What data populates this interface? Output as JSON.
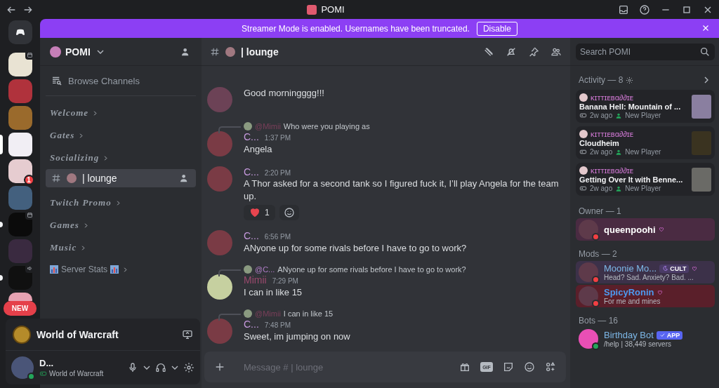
{
  "titlebar": {
    "title": "POMI"
  },
  "banner": {
    "text": "Streamer Mode is enabled. Usernames have been truncated.",
    "button": "Disable"
  },
  "servers": [
    {
      "kind": "event",
      "selected": false,
      "unread": false
    },
    {
      "kind": "plain",
      "selected": false,
      "unread": false
    },
    {
      "kind": "plain",
      "selected": false,
      "unread": false
    },
    {
      "kind": "plain",
      "selected": true,
      "unread": false
    },
    {
      "kind": "plain",
      "selected": false,
      "unread": false,
      "badge": "1"
    },
    {
      "kind": "plain",
      "selected": false,
      "unread": false
    },
    {
      "kind": "event",
      "selected": false,
      "unread": true
    },
    {
      "kind": "plain",
      "selected": false,
      "unread": false
    },
    {
      "kind": "voice",
      "selected": false,
      "unread": true
    },
    {
      "kind": "plain",
      "selected": false,
      "unread": false
    }
  ],
  "rail_pill": "NEW",
  "sidebar": {
    "server_name": "POMI",
    "browse": "Browse Channels",
    "categories": [
      {
        "kind": "fancy",
        "name": "Welcome"
      },
      {
        "kind": "fancy",
        "name": "Gates"
      },
      {
        "kind": "fancy",
        "name": "Socializing",
        "channels": [
          {
            "name": "| lounge",
            "selected": true
          }
        ]
      },
      {
        "kind": "fancy",
        "name": "Twitch Promo"
      },
      {
        "kind": "fancy",
        "name": "Games"
      },
      {
        "kind": "fancy",
        "name": "Music"
      },
      {
        "kind": "stats",
        "name": "Server Stats"
      }
    ]
  },
  "activity_panel": {
    "game": "World of Warcraft"
  },
  "user_panel": {
    "name": "D...",
    "status": "World of Warcraft"
  },
  "chat": {
    "channel": "| lounge",
    "messages": [
      {
        "kind": "continuation",
        "text": "Good morningggg!!!"
      },
      {
        "kind": "message",
        "reply": {
          "author": "@Mimii",
          "color": "#7b3f5a",
          "text": "Who were you playing as"
        },
        "author": "C...",
        "color": "#c79adf",
        "time": "1:37 PM",
        "text": "Angela"
      },
      {
        "kind": "message",
        "author": "C...",
        "color": "#c79adf",
        "time": "2:20 PM",
        "text": "A Thor asked for a second tank so I figured fuck it, I’ll play Angela for the team up.",
        "reactions": [
          {
            "count": "1"
          }
        ]
      },
      {
        "kind": "message",
        "author": "C...",
        "color": "#c79adf",
        "time": "6:56 PM",
        "text": "ANyone up for some rivals before I have to go to work?"
      },
      {
        "kind": "message",
        "reply": {
          "author": "@C...",
          "color": "#b07ec8",
          "text": "ANyone up for some rivals before I have to go to work?"
        },
        "author": "Mimii",
        "color": "#9b4a6e",
        "time": "7:29 PM",
        "text": "I can in like 15"
      },
      {
        "kind": "message",
        "reply": {
          "author": "@Mimii",
          "color": "#7b3f5a",
          "text": "I can in like 15"
        },
        "author": "C...",
        "color": "#c79adf",
        "time": "7:48 PM",
        "text": "Sweet, im jumping on now"
      }
    ],
    "composer": {
      "placeholder": "Message # | lounge",
      "gif_label": "GIF"
    }
  },
  "members": {
    "search": {
      "placeholder": "Search POMI"
    },
    "activity_title": "Activity — 8",
    "activities": [
      {
        "user": "ᴋɪᴛᴛɪᴇʙα∂∂ɪᴇ",
        "game": "Banana Hell: Mountain of ...",
        "ago": "2w ago",
        "tag": "New Player"
      },
      {
        "user": "ᴋɪᴛᴛɪᴇʙα∂∂ɪᴇ",
        "game": "Cloudheim",
        "ago": "2w ago",
        "tag": "New Player"
      },
      {
        "user": "ᴋɪᴛᴛɪᴇʙα∂∂ɪᴇ",
        "game": "Getting Over It with Benne...",
        "ago": "2w ago",
        "tag": "New Player"
      }
    ],
    "groups": [
      {
        "title": "Owner — 1",
        "members": [
          {
            "name": "queenpoohi",
            "color": "#ffffff",
            "kind": "owner"
          }
        ]
      },
      {
        "title": "Mods — 2",
        "members": [
          {
            "name": "Moonie Mo...",
            "color": "#7db8e8",
            "kind": "mod",
            "tag": "CULT",
            "status": "Head? Sad. Anxiety? Bad. ..."
          },
          {
            "name": "SpicyRonin",
            "color": "#4d9bf0",
            "kind": "spicy",
            "status": "For me and mines"
          }
        ]
      },
      {
        "title": "Bots — 16",
        "members": [
          {
            "name": "Birthday Bot",
            "color": "#7db8e8",
            "kind": "bot",
            "tag": "APP",
            "status": "/help | 38,449 servers"
          }
        ]
      }
    ]
  }
}
